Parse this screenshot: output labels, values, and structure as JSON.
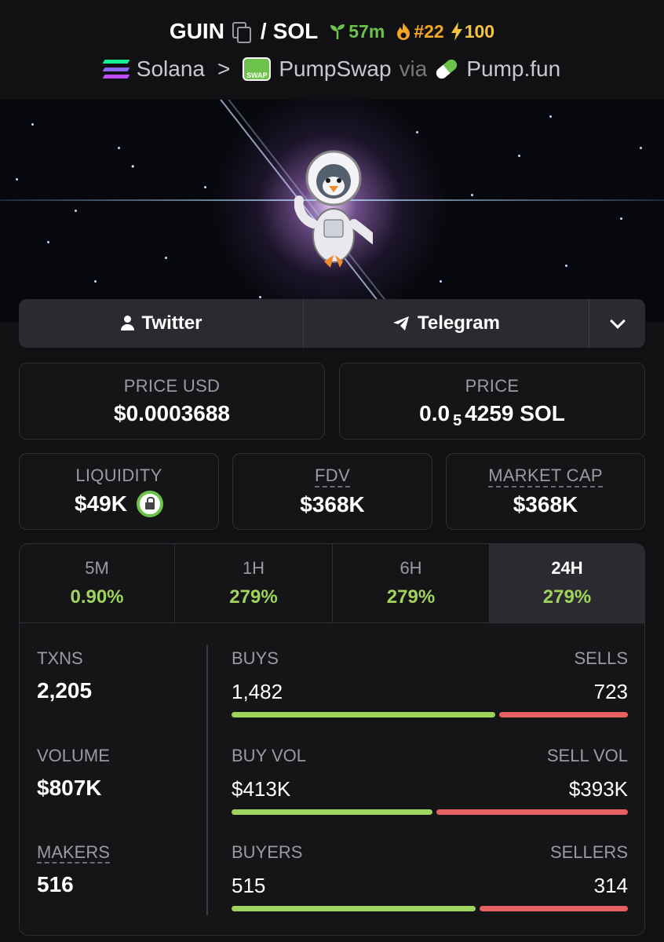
{
  "header": {
    "base": "GUIN",
    "sep": "/",
    "quote": "SOL",
    "age": "57m",
    "rank": "#22",
    "boost": "100",
    "chain": "Solana",
    "arrow": ">",
    "dex": "PumpSwap",
    "via": "via",
    "launchpad": "Pump.fun",
    "swap_badge": "SWAP"
  },
  "social": {
    "twitter": "Twitter",
    "telegram": "Telegram"
  },
  "price": {
    "usd_label": "PRICE USD",
    "usd_value": "$0.0003688",
    "native_label": "PRICE",
    "native_prefix": "0.0",
    "native_zeros": "5",
    "native_digits": "4259 SOL"
  },
  "metrics": {
    "liquidity_label": "LIQUIDITY",
    "liquidity_value": "$49K",
    "fdv_label": "FDV",
    "fdv_value": "$368K",
    "mcap_label": "MARKET CAP",
    "mcap_value": "$368K"
  },
  "tabs": [
    {
      "label": "5M",
      "value": "0.90%"
    },
    {
      "label": "1H",
      "value": "279%"
    },
    {
      "label": "6H",
      "value": "279%"
    },
    {
      "label": "24H",
      "value": "279%"
    }
  ],
  "active_tab": "24H",
  "stats": {
    "txns_label": "TXNS",
    "txns_value": "2,205",
    "volume_label": "VOLUME",
    "volume_value": "$807K",
    "makers_label": "MAKERS",
    "makers_value": "516",
    "buys_label": "BUYS",
    "buys_value": "1,482",
    "sells_label": "SELLS",
    "sells_value": "723",
    "buyvol_label": "BUY VOL",
    "buyvol_value": "$413K",
    "sellvol_label": "SELL VOL",
    "sellvol_value": "$393K",
    "buyers_label": "BUYERS",
    "buyers_value": "515",
    "sellers_label": "SELLERS",
    "sellers_value": "314"
  },
  "ratios": {
    "buys_fraction": 0.672,
    "buyvol_fraction": 0.512,
    "buyers_fraction": 0.621
  },
  "colors": {
    "green": "#9fd45c",
    "red": "#e5605e",
    "age_green": "#6cc24a",
    "rank_orange": "#f5a623",
    "boost_yellow": "#f5c342"
  }
}
